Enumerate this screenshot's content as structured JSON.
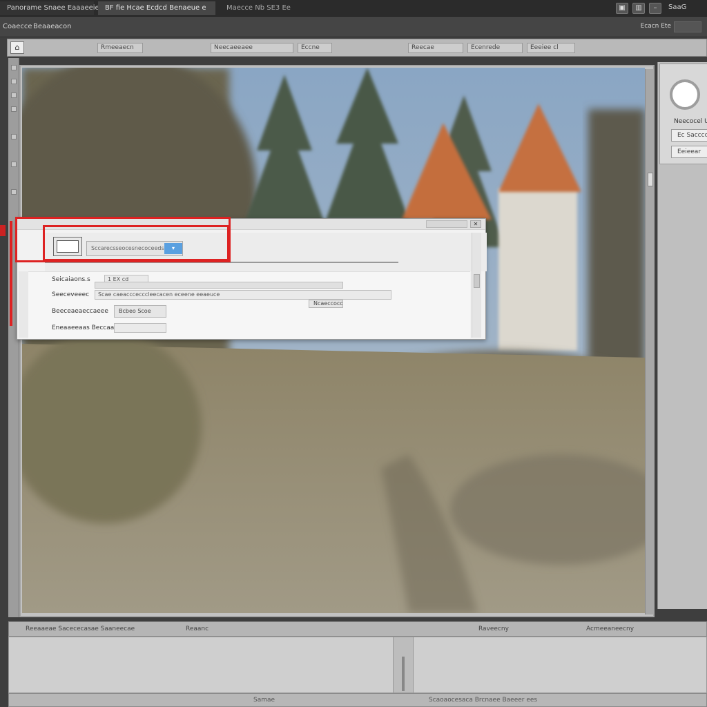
{
  "titlebar": {
    "tabs": [
      "Panorame Snaee Eaaaeeie ie",
      "BF fie Hcae Ecdcd Benaeue e",
      "Maecce   Nb   SE3   Ee"
    ],
    "right_label": "SaaG"
  },
  "menubar": {
    "items": [
      "Coaecce",
      "Beaaeacon"
    ],
    "right_label": "Ecacn Ete"
  },
  "toolbar": {
    "fields": [
      "Rmeeaecn",
      "Neecaeeaee",
      "Eccne",
      "Reecae",
      "Ecenrede",
      "Eeeiee cl"
    ]
  },
  "right_panel": {
    "label": "Neecocel Ue",
    "input_1": "Ec  Sacccce",
    "input_2": "Eeieear"
  },
  "dialog": {
    "dropdown_value": "Sccarecsseocesnecoceedse",
    "rows": [
      {
        "label": "Seicaiaons.s",
        "value": "1 EX cd"
      },
      {
        "label": "Seeceveeec",
        "value": "Scae caeacccecccleecacen eceene eeaeuce"
      },
      {
        "label": "Beeceaeaeccaeee",
        "value": "Bcbeo Scoe"
      },
      {
        "label": "Eneaaeeaas Beccaae",
        "value": ""
      }
    ],
    "side_button": "Ncaeccocc"
  },
  "bottom": {
    "bar_labels": [
      "Reeaaeae Sacececasae Saaneecae",
      "Reaanc",
      "Raveecny",
      "Acmeeaneecny"
    ],
    "status_labels": [
      "Samae",
      "Scaoaocesaca Brcnaee Baeeer ees"
    ]
  },
  "colors": {
    "highlight": "#dd2222",
    "accent_blue": "#5aa0e0"
  }
}
